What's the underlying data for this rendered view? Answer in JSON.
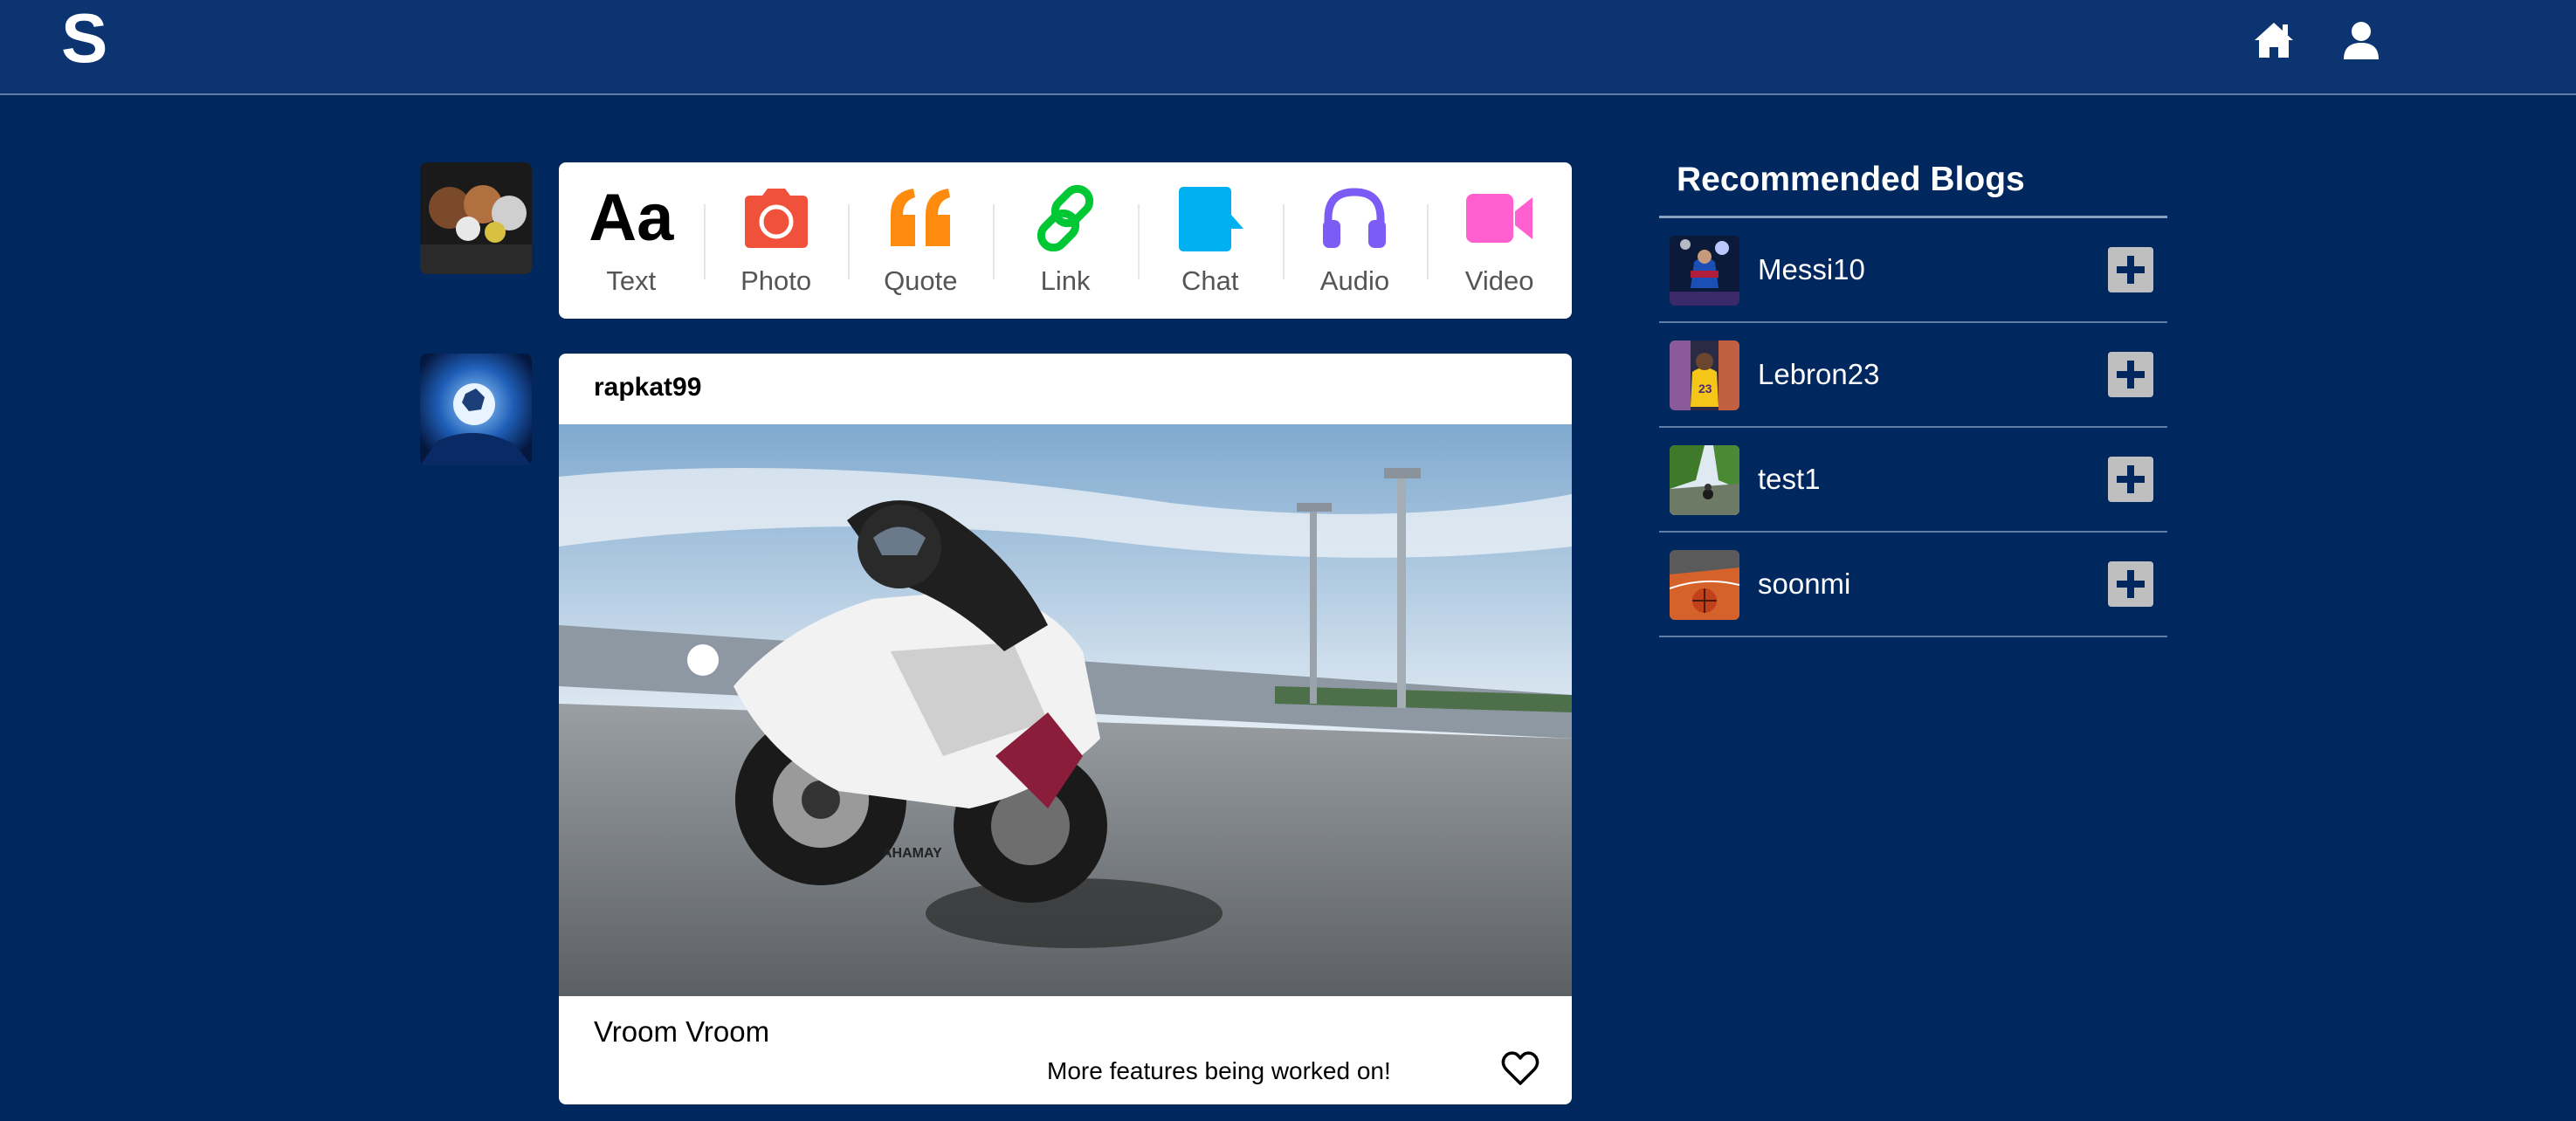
{
  "app": {
    "logo": "S"
  },
  "nav": {
    "home_icon": "home-icon",
    "user_icon": "user-icon"
  },
  "composer": {
    "items": [
      {
        "label": "Text",
        "glyph": "Aa",
        "icon": "text-icon",
        "color": "#000000"
      },
      {
        "label": "Photo",
        "icon": "camera-icon",
        "color": "#f0513a"
      },
      {
        "label": "Quote",
        "icon": "quote-icon",
        "color": "#ff8b0e"
      },
      {
        "label": "Link",
        "icon": "link-icon",
        "color": "#00c734"
      },
      {
        "label": "Chat",
        "icon": "chat-icon",
        "color": "#00b0f0"
      },
      {
        "label": "Audio",
        "icon": "headphones-icon",
        "color": "#7c5cf5"
      },
      {
        "label": "Video",
        "icon": "video-camera-icon",
        "color": "#ff5fcf"
      }
    ]
  },
  "post": {
    "username": "rapkat99",
    "caption": "Vroom Vroom",
    "note": "More features being worked on!",
    "like_icon": "heart-outline-icon"
  },
  "recommended": {
    "title": "Recommended Blogs",
    "blogs": [
      {
        "name": "Messi10"
      },
      {
        "name": "Lebron23"
      },
      {
        "name": "test1"
      },
      {
        "name": "soonmi"
      }
    ]
  },
  "colors": {
    "background": "#00275e",
    "topbar": "#0b3470",
    "add_button": "#bfbfbf"
  }
}
